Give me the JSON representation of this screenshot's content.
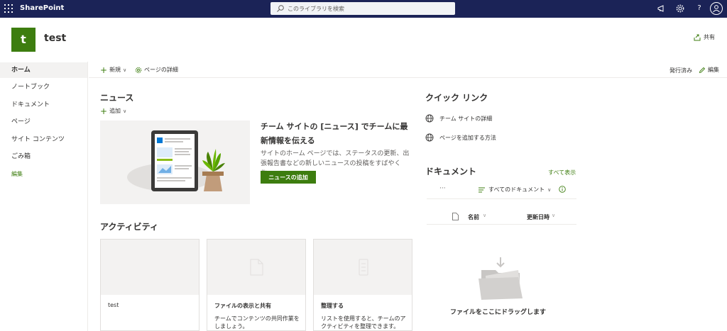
{
  "suite": {
    "brand": "SharePoint",
    "search_placeholder": "このライブラリを検索"
  },
  "site": {
    "logo_letter": "t",
    "title": "test",
    "share_label": "共有"
  },
  "nav": {
    "items": [
      {
        "label": "ホーム",
        "active": true
      },
      {
        "label": "ノートブック"
      },
      {
        "label": "ドキュメント"
      },
      {
        "label": "ページ"
      },
      {
        "label": "サイト コンテンツ"
      },
      {
        "label": "ごみ箱"
      }
    ],
    "edit_label": "編集"
  },
  "commandbar": {
    "new_label": "新規",
    "page_details_label": "ページの詳細",
    "status": "発行済み",
    "edit_label": "編集"
  },
  "news": {
    "heading": "ニュース",
    "add_label": "追加",
    "title": "チーム サイトの [ニュース] でチームに最新情報を伝える",
    "description": "サイトのホーム ページでは、ステータスの更新、出張報告書などの新しいニュースの投稿をすばやく作...",
    "button_label": "ニュースの追加"
  },
  "activity": {
    "heading": "アクティビティ",
    "cards": [
      {
        "title": "test",
        "desc": ""
      },
      {
        "title": "ファイルの表示と共有",
        "desc": "チームでコンテンツの共同作業をしましょう。"
      },
      {
        "title": "整理する",
        "desc": "リストを使用すると、チームのアクティビティを整理できます。"
      }
    ]
  },
  "quicklinks": {
    "heading": "クイック リンク",
    "items": [
      {
        "label": "チーム サイトの詳細"
      },
      {
        "label": "ページを追加する方法"
      }
    ]
  },
  "documents": {
    "heading": "ドキュメント",
    "show_all_label": "すべて表示",
    "more_label": "···",
    "view_label": "すべてのドキュメント",
    "col_name": "名前",
    "col_modified": "更新日時",
    "drop_message": "ファイルをここにドラッグします"
  },
  "colors": {
    "suitebar": "#1b2357",
    "accent": "#3d7d0f"
  }
}
